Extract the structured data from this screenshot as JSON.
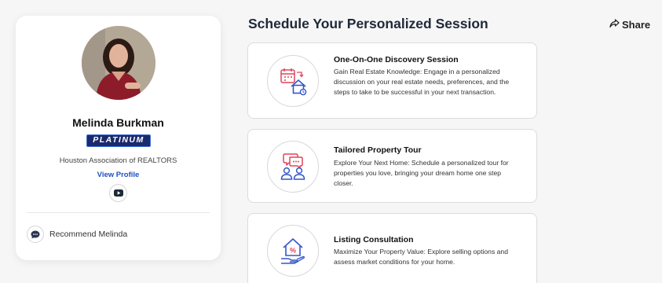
{
  "agent": {
    "name": "Melinda Burkman",
    "tier": "PLATINUM",
    "association": "Houston Association of REALTORS",
    "view_profile": "View Profile",
    "recommend_label": "Recommend Melinda"
  },
  "header": {
    "title": "Schedule Your Personalized Session",
    "share_label": "Share"
  },
  "sessions": [
    {
      "title": "One-On-One Discovery Session",
      "description": "Gain Real Estate Knowledge: Engage in a personalized discussion on your real estate needs, preferences, and the steps to take to be successful in your next transaction.",
      "icon": "calendar-house-icon"
    },
    {
      "title": "Tailored Property Tour",
      "description": "Explore Your Next Home: Schedule a personalized tour for properties you love, bringing your dream home one step closer.",
      "icon": "chat-people-icon"
    },
    {
      "title": "Listing Consultation",
      "description": "Maximize Your Property Value: Explore selling options and assess market conditions for your home.",
      "icon": "house-percent-hand-icon"
    }
  ],
  "colors": {
    "accent_blue": "#1e4fc4",
    "badge_navy": "#1a2a6c",
    "icon_red": "#e0455b",
    "icon_blue": "#3457c9",
    "page_bg": "#f6f6f7"
  }
}
